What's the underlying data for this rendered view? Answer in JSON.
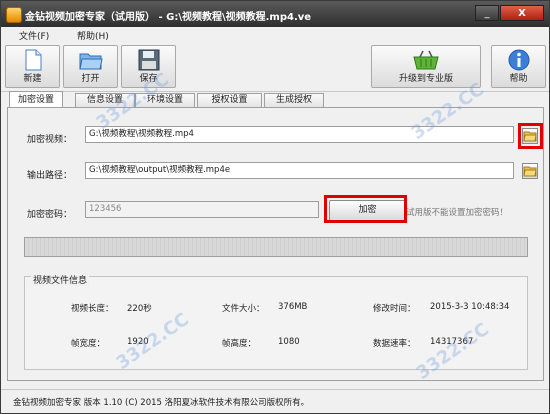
{
  "window": {
    "title": "金钻视频加密专家（试用版） - G:\\视频教程\\视频教程.mp4.ve",
    "min_label": "_",
    "close_label": "X"
  },
  "menu": {
    "file": "文件(F)",
    "help": "帮助(H)"
  },
  "toolbar": {
    "new_label": "新建",
    "open_label": "打开",
    "save_label": "保存",
    "upgrade_label": "升级到专业版",
    "help_label": "帮助"
  },
  "tabs": [
    "加密设置",
    "信息设置",
    "环境设置",
    "授权设置",
    "生成授权"
  ],
  "form": {
    "video_label": "加密视频：",
    "video_value": "G:\\视频教程\\视频教程.mp4",
    "output_label": "输出路径：",
    "output_value": "G:\\视频教程\\output\\视频教程.mp4e",
    "password_label": "加密密码：",
    "password_value": "123456",
    "encrypt_button": "加密",
    "hint": "试用版不能设置加密密码！"
  },
  "info": {
    "title": "视频文件信息",
    "length_label": "视频长度：",
    "length_value": "220秒",
    "size_label": "文件大小：",
    "size_value": "376MB",
    "mtime_label": "修改时间：",
    "mtime_value": "2015-3-3 10:48:34",
    "width_label": "帧宽度：",
    "width_value": "1920",
    "height_label": "帧高度：",
    "height_value": "1080",
    "rate_label": "数据速率：",
    "rate_value": "14317367"
  },
  "status": "金钻视频加密专家  版本 1.10 (C) 2015 洛阳夏冰软件技术有限公司版权所有。",
  "watermark": "3322.CC",
  "colors": {
    "titlebar": "#3a3a3a",
    "highlight": "#e00000",
    "close": "#c03020"
  }
}
